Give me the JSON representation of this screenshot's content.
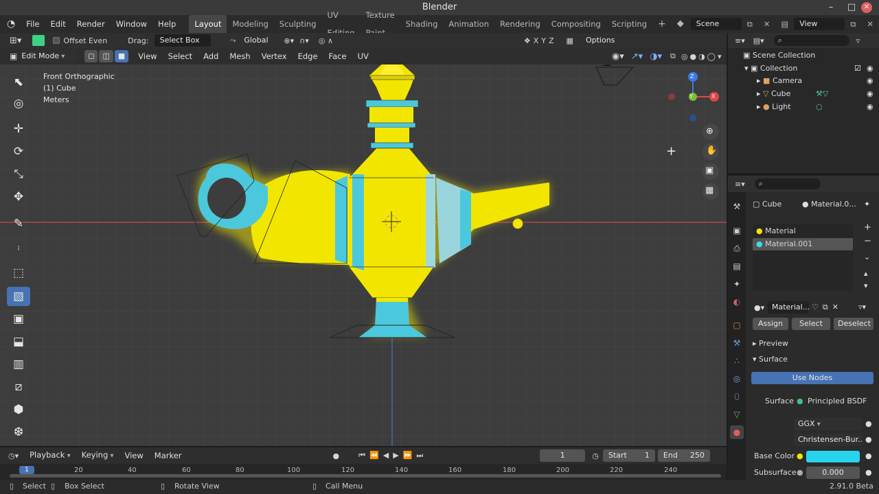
{
  "app": {
    "title": "Blender",
    "minimize": "–",
    "maximize": "□",
    "close": "✕"
  },
  "menus": [
    "File",
    "Edit",
    "Render",
    "Window",
    "Help"
  ],
  "workspaces": [
    "Layout",
    "Modeling",
    "Sculpting",
    "UV Editing",
    "Texture Paint",
    "Shading",
    "Animation",
    "Rendering",
    "Compositing",
    "Scripting"
  ],
  "scene": {
    "label": "Scene",
    "view_layer": "View Layer"
  },
  "tool_header": {
    "offset_even": "Offset Even",
    "drag_label": "Drag:",
    "drag_value": "Select Box",
    "orientation": "Global",
    "options": "Options"
  },
  "viewport_header": {
    "mode": "Edit Mode",
    "menus": [
      "View",
      "Select",
      "Add",
      "Mesh",
      "Vertex",
      "Edge",
      "Face",
      "UV"
    ]
  },
  "overlay": {
    "view": "Front Orthographic",
    "object": "(1) Cube",
    "units": "Meters"
  },
  "axis": {
    "x": "X",
    "y": "Y",
    "z": "Z"
  },
  "outliner": {
    "scene_collection": "Scene Collection",
    "collection": "Collection",
    "items": [
      "Camera",
      "Cube",
      "Light"
    ]
  },
  "properties": {
    "object": "Cube",
    "material_slot": "Material.0...",
    "materials": [
      "Material",
      "Material.001"
    ],
    "material_name": "Material...",
    "assign": "Assign",
    "select": "Select",
    "deselect": "Deselect",
    "preview": "Preview",
    "surface": "Surface",
    "use_nodes": "Use Nodes",
    "surface_label": "Surface",
    "surface_value": "Principled BSDF",
    "distribution": "GGX",
    "subsurface_method": "Christensen-Bur...",
    "base_color_label": "Base Color",
    "base_color": "#28d4ec",
    "subsurface_label": "Subsurface",
    "subsurface_value": "0.000"
  },
  "timeline": {
    "menus": [
      "Playback",
      "Keying",
      "View",
      "Marker"
    ],
    "current_frame": "1",
    "start_label": "Start",
    "start": "1",
    "end_label": "End",
    "end": "250",
    "playhead": "1",
    "ticks": [
      "20",
      "40",
      "60",
      "80",
      "100",
      "120",
      "140",
      "160",
      "180",
      "200",
      "220",
      "240"
    ]
  },
  "status": {
    "select": "Select",
    "box_select": "Box Select",
    "rotate": "Rotate View",
    "call_menu": "Call Menu",
    "version": "2.91.0 Beta"
  },
  "colors": {
    "accent": "#4772b3",
    "lamp_yellow": "#f2e600",
    "lamp_cyan": "#4cc8dc",
    "x_axis": "#e04848",
    "y_axis": "#78c030",
    "z_axis": "#3c78e8"
  }
}
